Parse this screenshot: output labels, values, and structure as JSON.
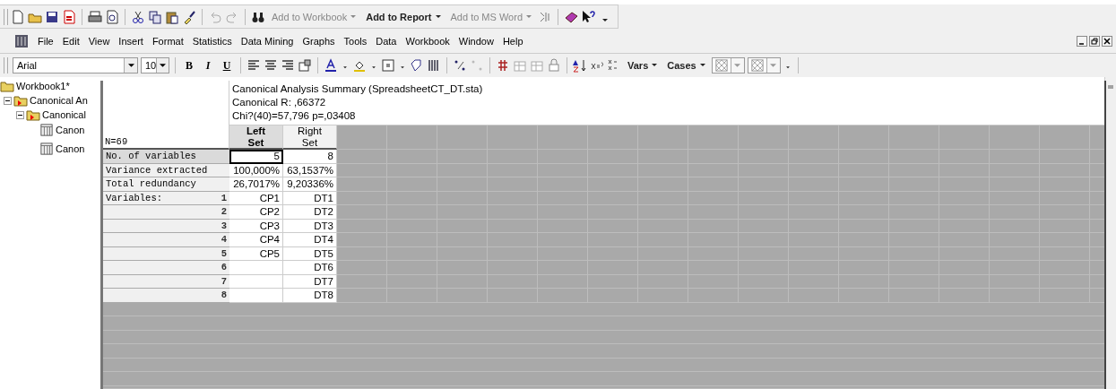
{
  "toolbar": {
    "buttons": [
      {
        "label": "Add to Workbook",
        "disabled": true
      },
      {
        "label": "Add to Report",
        "disabled": false
      },
      {
        "label": "Add to MS Word",
        "disabled": true
      }
    ]
  },
  "menu_bar": {
    "items": [
      "File",
      "Edit",
      "View",
      "Insert",
      "Format",
      "Statistics",
      "Data Mining",
      "Graphs",
      "Tools",
      "Data",
      "Workbook",
      "Window",
      "Help"
    ]
  },
  "format_toolbar": {
    "font": "Arial",
    "size": "10",
    "style_buttons": [
      "B",
      "I",
      "U"
    ],
    "dropdowns": [
      "Vars",
      "Cases"
    ]
  },
  "tree": {
    "label": "Workbook1*",
    "children": [
      {
        "label": "Canonical An",
        "expanded": true,
        "children": [
          {
            "label": "Canonical",
            "expanded": true,
            "children": [
              {
                "label": "Canon"
              },
              {
                "label": "Canon"
              }
            ]
          }
        ]
      }
    ]
  },
  "spreadsheet": {
    "title_lines": [
      "Canonical Analysis Summary (SpreadsheetCT_DT.sta)",
      "Canonical R: ,66372",
      "Chi?(40)=57,796 p=,03408"
    ],
    "corner": "N=69",
    "columns": [
      {
        "lines": [
          "Left",
          "Set"
        ],
        "selected": true
      },
      {
        "lines": [
          "Right",
          "Set"
        ],
        "selected": false
      }
    ],
    "rows": [
      {
        "label": "No. of variables",
        "selected": true,
        "cells": [
          {
            "text": "5",
            "focused": true
          },
          {
            "text": "8",
            "focused": false
          }
        ]
      },
      {
        "label": "Variance extracted",
        "selected": false,
        "cells": [
          {
            "text": "100,000%",
            "focused": false
          },
          {
            "text": "63,1537%",
            "focused": false
          }
        ]
      },
      {
        "label": "Total redundancy",
        "selected": false,
        "cells": [
          {
            "text": "26,7017%",
            "focused": false
          },
          {
            "text": "9,20336%",
            "focused": false
          }
        ]
      },
      {
        "label": "Variables:",
        "number": "1",
        "selected": false,
        "cells": [
          {
            "text": "CP1",
            "focused": false
          },
          {
            "text": "DT1",
            "focused": false
          }
        ]
      },
      {
        "number": "2",
        "selected": false,
        "cells": [
          {
            "text": "CP2",
            "focused": false
          },
          {
            "text": "DT2",
            "focused": false
          }
        ]
      },
      {
        "number": "3",
        "selected": false,
        "cells": [
          {
            "text": "CP3",
            "focused": false
          },
          {
            "text": "DT3",
            "focused": false
          }
        ]
      },
      {
        "number": "4",
        "selected": false,
        "cells": [
          {
            "text": "CP4",
            "focused": false
          },
          {
            "text": "DT4",
            "focused": false
          }
        ]
      },
      {
        "number": "5",
        "selected": false,
        "cells": [
          {
            "text": "CP5",
            "focused": false
          },
          {
            "text": "DT5",
            "focused": false
          }
        ]
      },
      {
        "number": "6",
        "selected": false,
        "cells": [
          {
            "focused": false
          },
          {
            "text": "DT6",
            "focused": false
          }
        ]
      },
      {
        "number": "7",
        "selected": false,
        "cells": [
          {
            "focused": false
          },
          {
            "text": "DT7",
            "focused": false
          }
        ]
      },
      {
        "number": "8",
        "selected": false,
        "cells": [
          {
            "focused": false
          },
          {
            "text": "DT8",
            "focused": false
          }
        ]
      }
    ]
  }
}
